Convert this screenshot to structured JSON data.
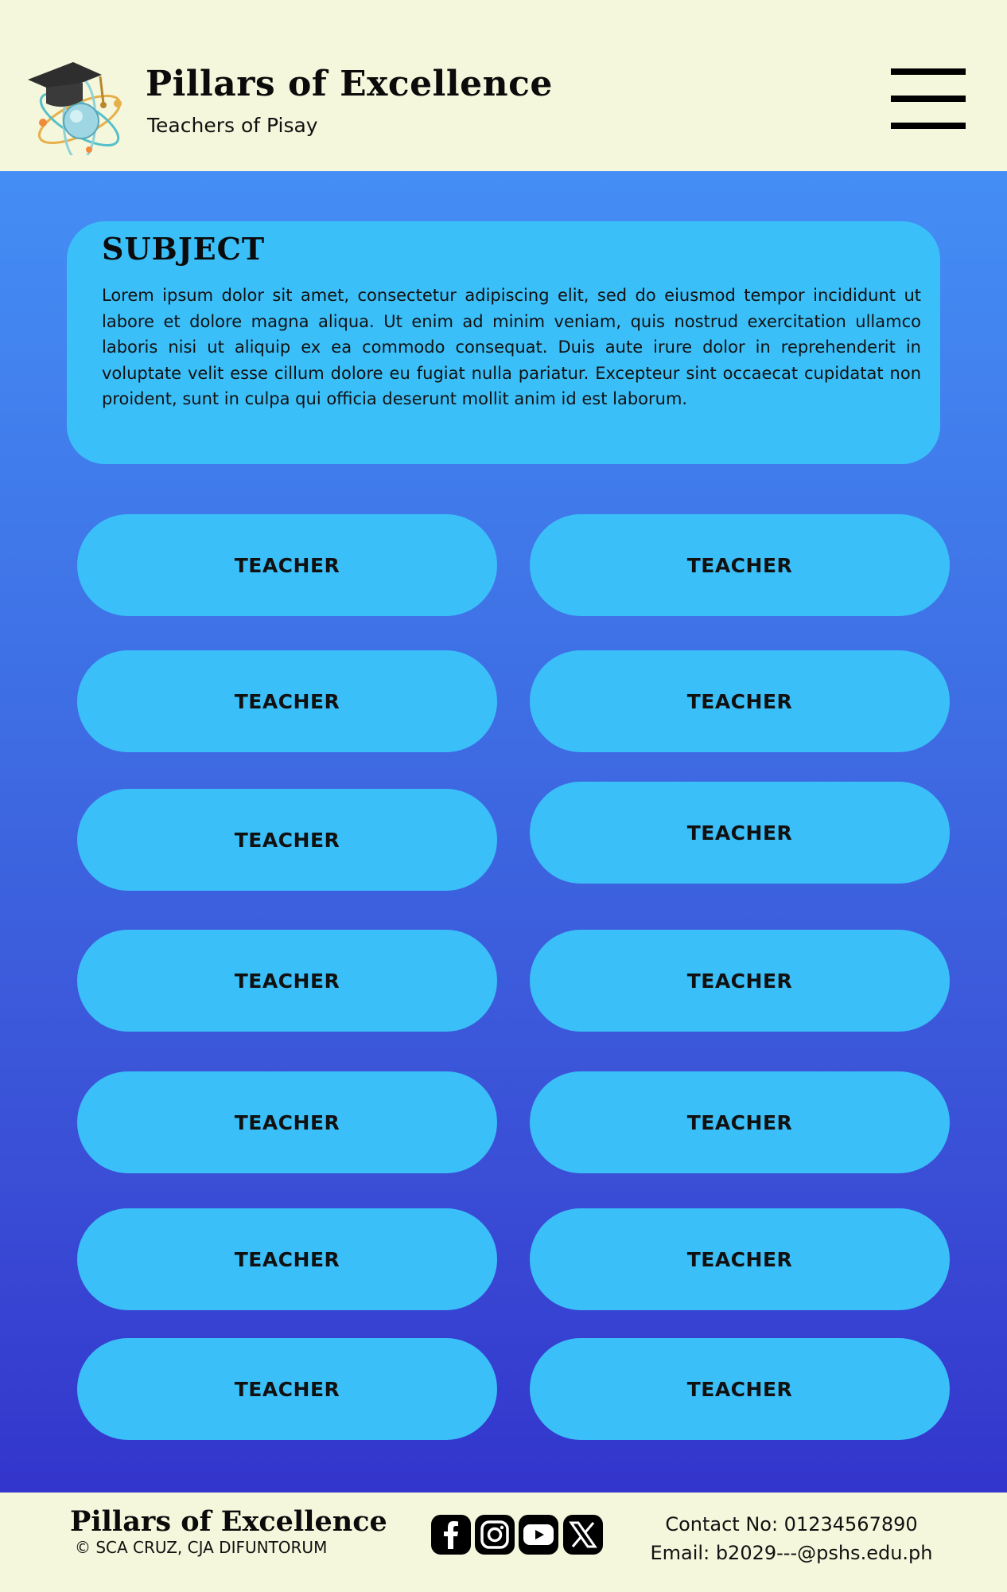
{
  "header": {
    "title": "Pillars of Excellence",
    "subtitle": "Teachers of Pisay",
    "logo_icon": "graduation-cap-atom-logo",
    "menu_icon": "hamburger-menu-icon"
  },
  "subject": {
    "title": "SUBJECT",
    "description": "Lorem ipsum dolor sit amet, consectetur adipiscing elit, sed do eiusmod tempor incididunt ut labore et dolore magna aliqua. Ut enim ad minim veniam, quis nostrud exercitation ullamco laboris nisi ut aliquip ex ea commodo consequat. Duis aute irure dolor in reprehenderit in voluptate velit esse cillum dolore eu fugiat nulla pariatur. Excepteur sint occaecat cupidatat non proident, sunt in culpa qui officia deserunt mollit anim id est laborum."
  },
  "teachers": [
    {
      "label": "TEACHER"
    },
    {
      "label": "TEACHER"
    },
    {
      "label": "TEACHER"
    },
    {
      "label": "TEACHER"
    },
    {
      "label": "TEACHER"
    },
    {
      "label": "TEACHER"
    },
    {
      "label": "TEACHER"
    },
    {
      "label": "TEACHER"
    },
    {
      "label": "TEACHER"
    },
    {
      "label": "TEACHER"
    },
    {
      "label": "TEACHER"
    },
    {
      "label": "TEACHER"
    },
    {
      "label": "TEACHER"
    },
    {
      "label": "TEACHER"
    }
  ],
  "footer": {
    "title": "Pillars of Excellence",
    "copyright": "© SCA CRUZ, CJA DIFUNTORUM",
    "social_icons": [
      "facebook-icon",
      "instagram-icon",
      "youtube-icon",
      "x-icon"
    ],
    "contact_no": "Contact No: 01234567890",
    "email": "Email: b2029---@pshs.edu.ph"
  },
  "colors": {
    "background": "#f5f7dc",
    "card": "#3bbff9",
    "gradient_top": "#448ef5",
    "gradient_bottom": "#3335cc"
  }
}
